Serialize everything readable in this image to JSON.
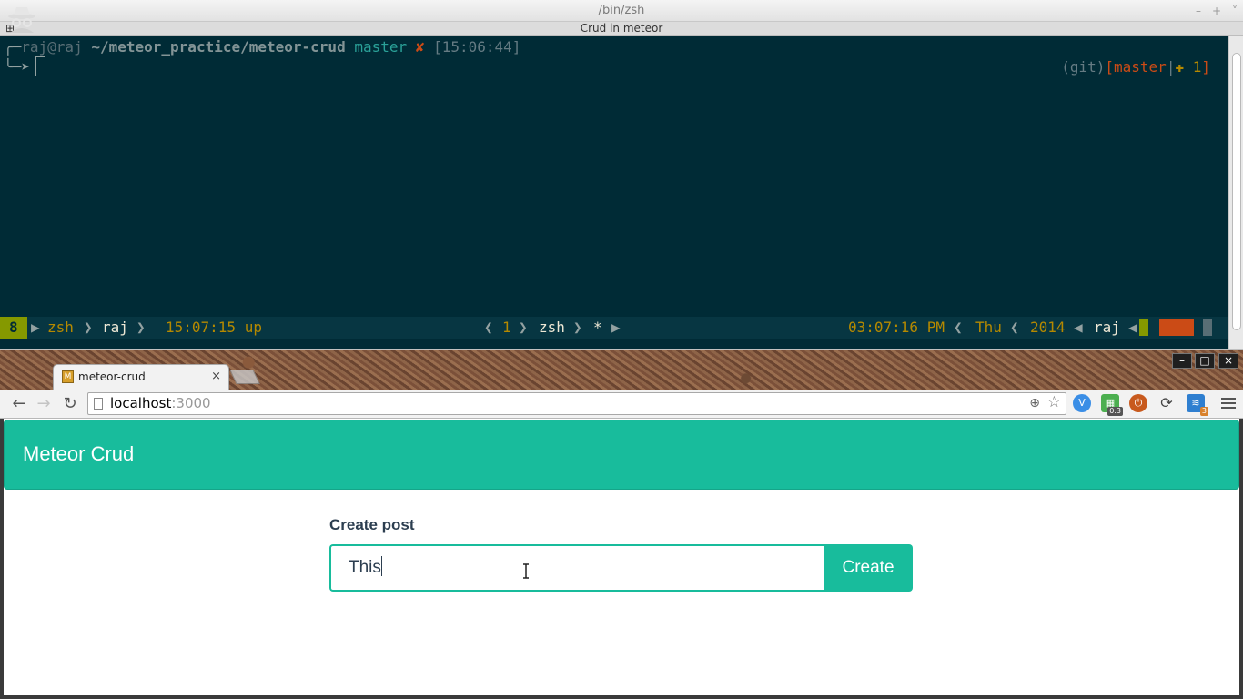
{
  "terminal": {
    "window_title": "/bin/zsh",
    "window_controls": [
      "–",
      "+",
      "˅"
    ],
    "tab_title": "Crud in meteor",
    "prompt": {
      "user": "raj@raj",
      "path": "~/meteor_practice/meteor-crud",
      "branch": "master",
      "dirty_mark": "✘",
      "time": "[15:06:44]"
    },
    "right_prompt": {
      "git": "(git)",
      "open": "[",
      "branch": "master",
      "sep": "|",
      "plus": "✚ 1",
      "close": "]"
    },
    "statusbar": {
      "window_num": "8",
      "shell": "zsh",
      "user": "raj",
      "uptime": "15:07:15 up",
      "pane": "1",
      "pane_shell": "zsh",
      "pane_flag": "*",
      "clock": "03:07:16 PM",
      "day": "Thu",
      "year": "2014",
      "host": "raj"
    }
  },
  "browser": {
    "tab_title": "meteor-crud",
    "tab_close": "×",
    "favicon_glyph": "M",
    "url_host": "localhost",
    "url_port": ":3000",
    "window_controls": [
      "–",
      "□",
      "×"
    ],
    "extensions": [
      {
        "name": "V",
        "color": "#3a8ee6",
        "badge": ""
      },
      {
        "name": "▦",
        "color": "#4caf50",
        "badge": "0.3"
      },
      {
        "name": "⏻",
        "color": "#c85a1e",
        "badge": ""
      },
      {
        "name": "⟳",
        "color": "#555555",
        "badge": ""
      },
      {
        "name": "≋",
        "color": "#2f7fd0",
        "badge": "3"
      }
    ]
  },
  "page": {
    "brand": "Meteor Crud",
    "form_label": "Create post",
    "input_value": "This",
    "create_label": "Create",
    "accent": "#18bc9c"
  }
}
